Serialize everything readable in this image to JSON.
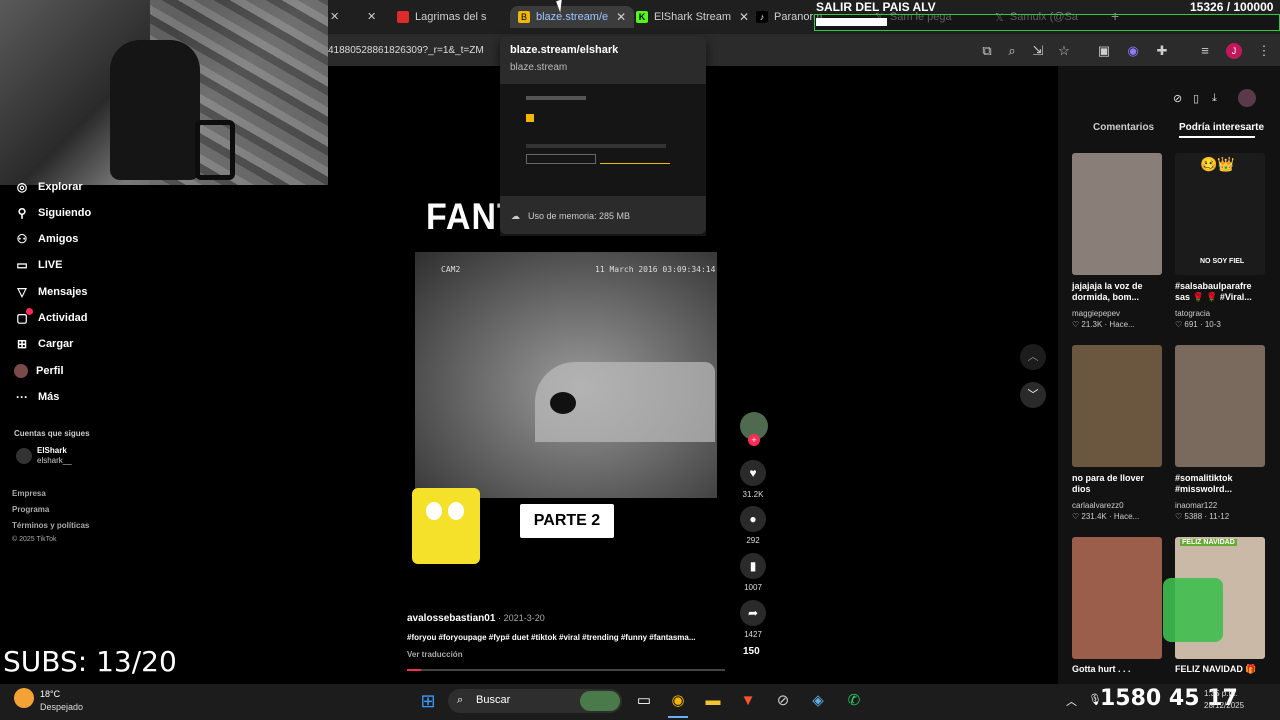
{
  "browser": {
    "tabs": [
      {
        "label": "Lagrimas del s",
        "icon": "youtube-icon"
      },
      {
        "label": "blaze.stream/e",
        "icon": "blaze-icon",
        "active": true
      },
      {
        "label": "ElShark Stream",
        "icon": "kick-icon"
      },
      {
        "label": "Paranorm",
        "icon": "tiktok-icon"
      },
      {
        "label": "Sam le pega",
        "icon": "x-icon"
      },
      {
        "label": "Samulx (@Sa",
        "icon": "x-icon"
      }
    ],
    "url": "41880528861826309?_r=1&_t=ZM",
    "profile_initial": "J"
  },
  "hovercard": {
    "title": "blaze.stream/elshark",
    "domain": "blaze.stream",
    "memory": "Uso de memoria: 285 MB"
  },
  "stream_goal": {
    "title": "SALIR DEL PAIS ALV",
    "count": "15326 / 100000",
    "progress": 0.15326
  },
  "subs_overlay": "SUBS: 13/20",
  "sidebar": {
    "items": [
      {
        "label": "Explorar",
        "icon": "compass-icon"
      },
      {
        "label": "Siguiendo",
        "icon": "person-icon"
      },
      {
        "label": "Amigos",
        "icon": "friends-icon"
      },
      {
        "label": "LIVE",
        "icon": "live-icon"
      },
      {
        "label": "Mensajes",
        "icon": "message-icon"
      },
      {
        "label": "Actividad",
        "icon": "activity-icon"
      },
      {
        "label": "Cargar",
        "icon": "upload-icon"
      },
      {
        "label": "Perfil",
        "icon": "profile-icon"
      },
      {
        "label": "Más",
        "icon": "more-icon"
      }
    ],
    "following_header": "Cuentas que sigues",
    "following": {
      "name": "ElShark",
      "handle": "elshark__"
    },
    "footer": [
      "Empresa",
      "Programa",
      "Términos y políticas",
      "© 2025 TikTok"
    ]
  },
  "video": {
    "overlay_title": "FANTA",
    "cam_tag": "CAM2",
    "cam_date": "11 March 2016 03:09:34:14",
    "parte_label": "PARTE 2",
    "author": "avalossebastian01",
    "date": "2021-3-20",
    "caption": "#foryou #foryoupage #fyp# duet #tiktok #viral #trending #funny #fantasma...",
    "translate": "Ver traducción",
    "likes": "31.2K",
    "comments": "292",
    "saves": "1007",
    "shares": "1427",
    "extra": "150"
  },
  "right_panel": {
    "tabs": [
      "Comentarios",
      "Podría interesarte"
    ],
    "videos": [
      {
        "caption": "jajajaja la voz de dormida, bom...",
        "user": "maggiepepev",
        "stats": "♡ 21.3K · Hace...",
        "thumb_color": "#8a7f78"
      },
      {
        "caption": "#salsabaulparafre sas 🌹 🌹 #Viral...",
        "user": "tatogracia",
        "stats": "♡ 691 · 10-3",
        "thumb_color": "#1b1b1b",
        "overlay": "NO SOY FIEL",
        "emoji": "🥴👑"
      },
      {
        "caption": "no para de llover dios",
        "user": "carlaalvarezz0",
        "stats": "♡ 231.4K · Hace...",
        "thumb_color": "#6b5640"
      },
      {
        "caption": "#somalitiktok #misswolrd...",
        "user": "inaomar122",
        "stats": "♡ 5388 · 11-12",
        "thumb_color": "#7a6a5e"
      },
      {
        "caption": "Gotta hurt . . .",
        "user": "",
        "stats": "",
        "thumb_color": "#9b5e4a"
      },
      {
        "caption": "FELIZ NAVIDAD 🎁",
        "user": "",
        "stats": "",
        "thumb_color": "#c9b9a6",
        "overlay": "FELIZ NAVIDAD"
      }
    ]
  },
  "taskbar": {
    "weather_temp": "18°C",
    "weather_desc": "Despejado",
    "search_label": "Buscar",
    "clock_overlay": "1580 45 17",
    "time": "1:35 p.m.",
    "date": "28/12/2025",
    "lang": "ESP\nLAA"
  }
}
